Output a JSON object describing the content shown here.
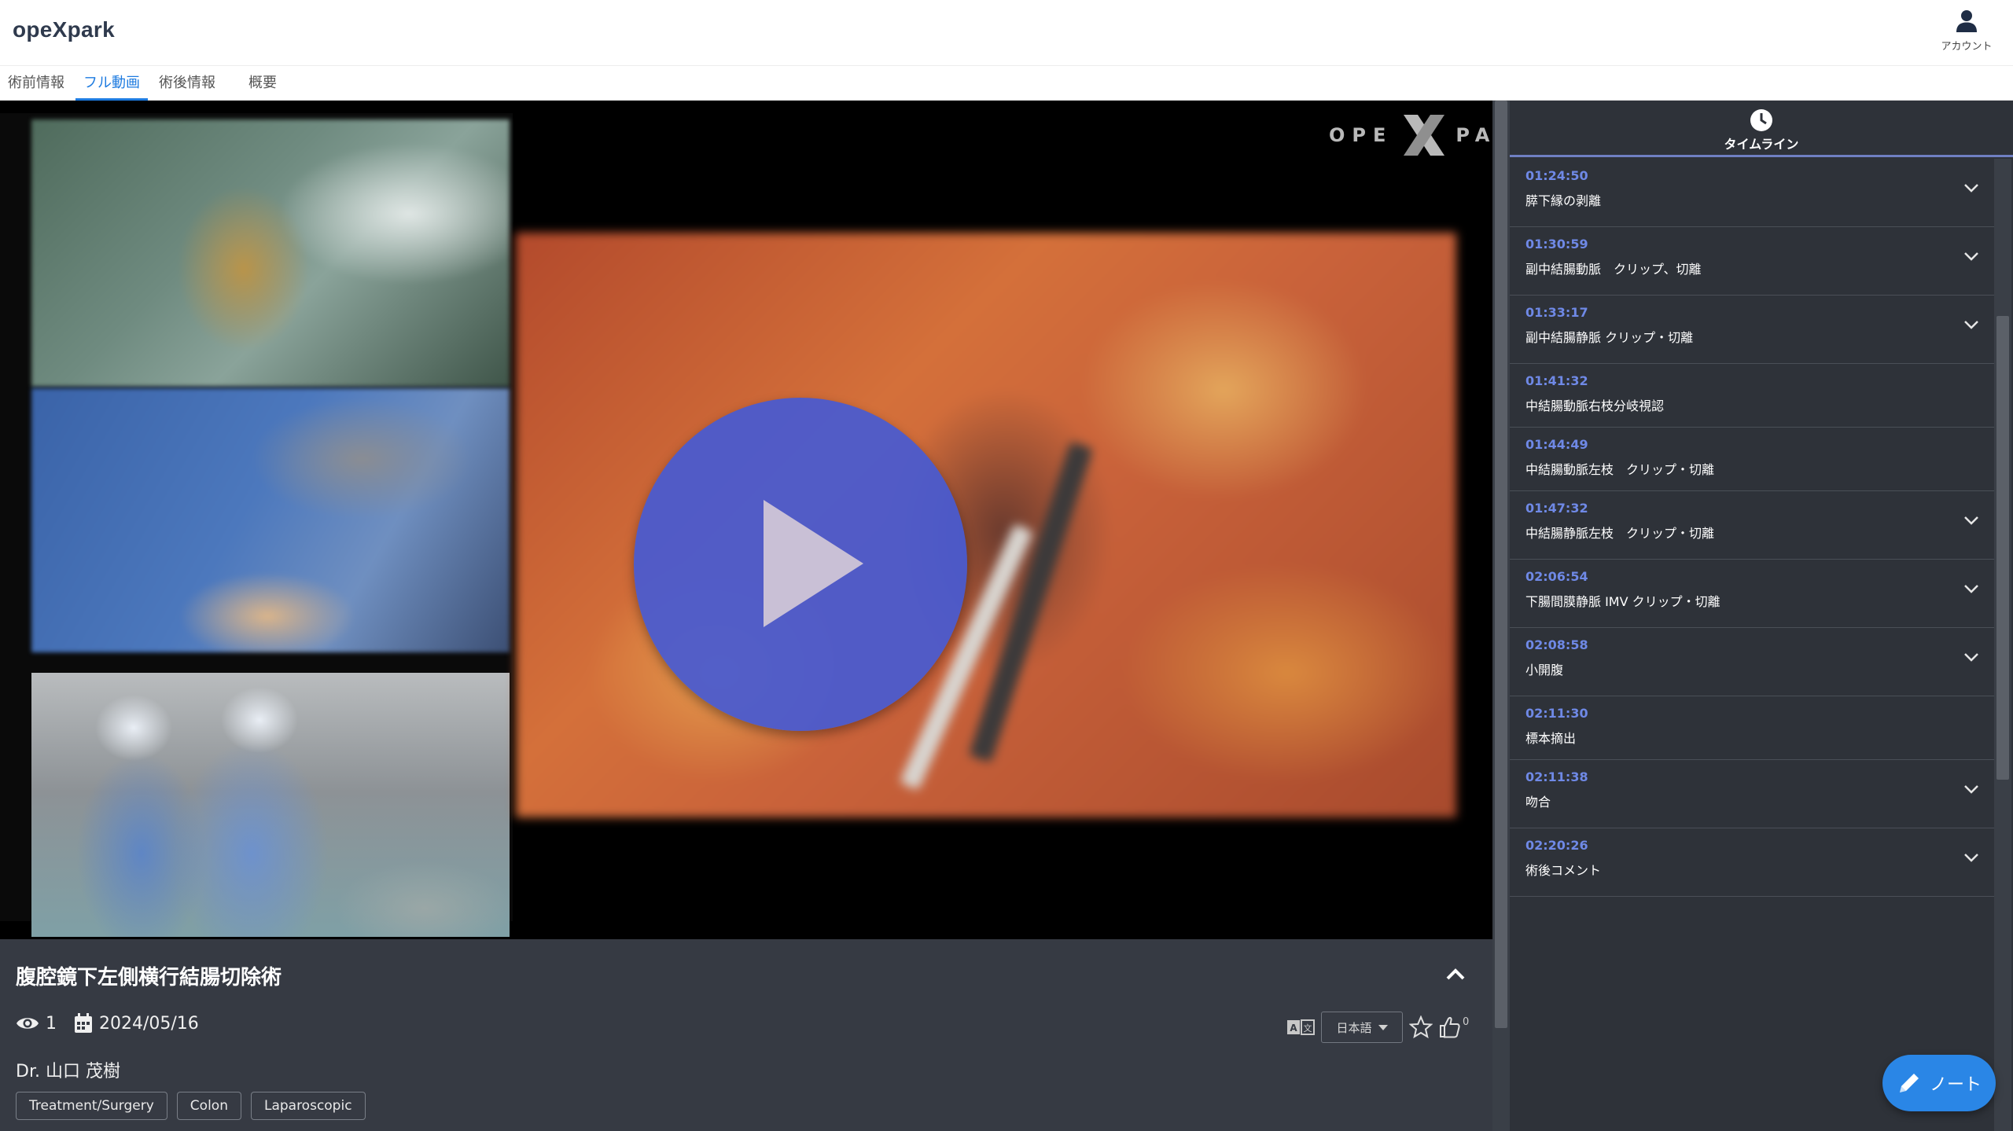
{
  "app": {
    "logo": "opeXpark",
    "account_label": "アカウント"
  },
  "tabs": [
    {
      "label": "術前情報",
      "active": false
    },
    {
      "label": "フル動画",
      "active": true
    },
    {
      "label": "術後情報",
      "active": false
    },
    {
      "label": "概要",
      "active": false
    }
  ],
  "player": {
    "watermark_left": "OPE",
    "watermark_right": "PARK",
    "play_icon": "play-icon"
  },
  "video": {
    "title": "腹腔鏡下左側横行結腸切除術",
    "views": "1",
    "date": "2024/05/16",
    "doctor": "Dr. 山口 茂樹",
    "tags": [
      "Treatment/Surgery",
      "Colon",
      "Laparoscopic"
    ],
    "language": "日本語",
    "likes": "0"
  },
  "timeline": {
    "title": "タイムライン",
    "items": [
      {
        "time": "01:24:50",
        "label": "膵下縁の剥離",
        "expandable": true
      },
      {
        "time": "01:30:59",
        "label": "副中結腸動脈　クリップ、切離",
        "expandable": true
      },
      {
        "time": "01:33:17",
        "label": "副中結腸静脈 クリップ・切離",
        "expandable": true
      },
      {
        "time": "01:41:32",
        "label": "中結腸動脈右枝分岐視認",
        "expandable": false
      },
      {
        "time": "01:44:49",
        "label": "中結腸動脈左枝　クリップ・切離",
        "expandable": false
      },
      {
        "time": "01:47:32",
        "label": "中結腸静脈左枝　クリップ・切離",
        "expandable": true
      },
      {
        "time": "02:06:54",
        "label": "下腸間膜静脈 IMV クリップ・切離",
        "expandable": true
      },
      {
        "time": "02:08:58",
        "label": "小開腹",
        "expandable": true
      },
      {
        "time": "02:11:30",
        "label": "標本摘出",
        "expandable": false
      },
      {
        "time": "02:11:38",
        "label": "吻合",
        "expandable": true
      },
      {
        "time": "02:20:26",
        "label": "術後コメント",
        "expandable": true
      }
    ]
  },
  "note_button": {
    "label": "ノート"
  },
  "colors": {
    "accent": "#1e7be0",
    "timestamp": "#6f89e6",
    "play_button": "#465ad2",
    "note_button": "#2a86e6"
  }
}
